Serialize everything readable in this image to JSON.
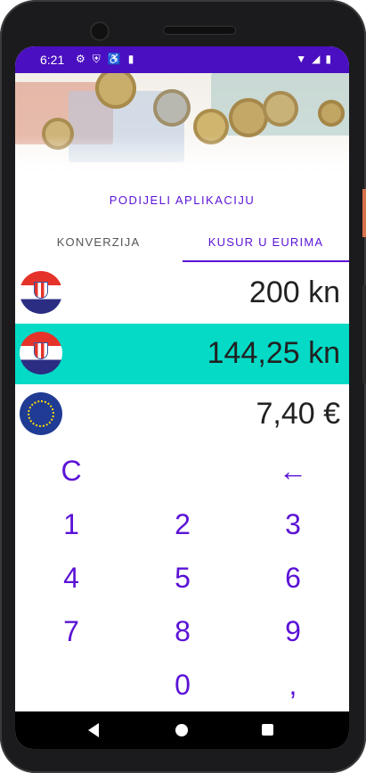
{
  "status_bar": {
    "time": "6:21",
    "left_icons": [
      "gear-icon",
      "shield-icon",
      "accessibility-icon",
      "sd-card-icon"
    ],
    "right_icons": [
      "wifi-icon",
      "signal-icon",
      "battery-icon"
    ]
  },
  "share_link": "PODIJELI APLIKACIJU",
  "tabs": [
    {
      "label": "KONVERZIJA",
      "selected": false
    },
    {
      "label": "KUSUR U EURIMA",
      "selected": true
    }
  ],
  "rows": [
    {
      "flag": "croatia-flag-icon",
      "amount": "200 kn",
      "highlighted": false
    },
    {
      "flag": "croatia-flag-icon",
      "amount": "144,25 kn",
      "highlighted": true
    },
    {
      "flag": "eu-flag-icon",
      "amount": "7,40 €",
      "highlighted": false
    }
  ],
  "keypad": {
    "clear": "C",
    "backspace": "←",
    "k1": "1",
    "k2": "2",
    "k3": "3",
    "k4": "4",
    "k5": "5",
    "k6": "6",
    "k7": "7",
    "k8": "8",
    "k9": "9",
    "k0": "0",
    "comma": ","
  },
  "colors": {
    "primary": "#5b12d6",
    "status_bar": "#4a0fc0",
    "highlight_row": "#04dac6"
  }
}
